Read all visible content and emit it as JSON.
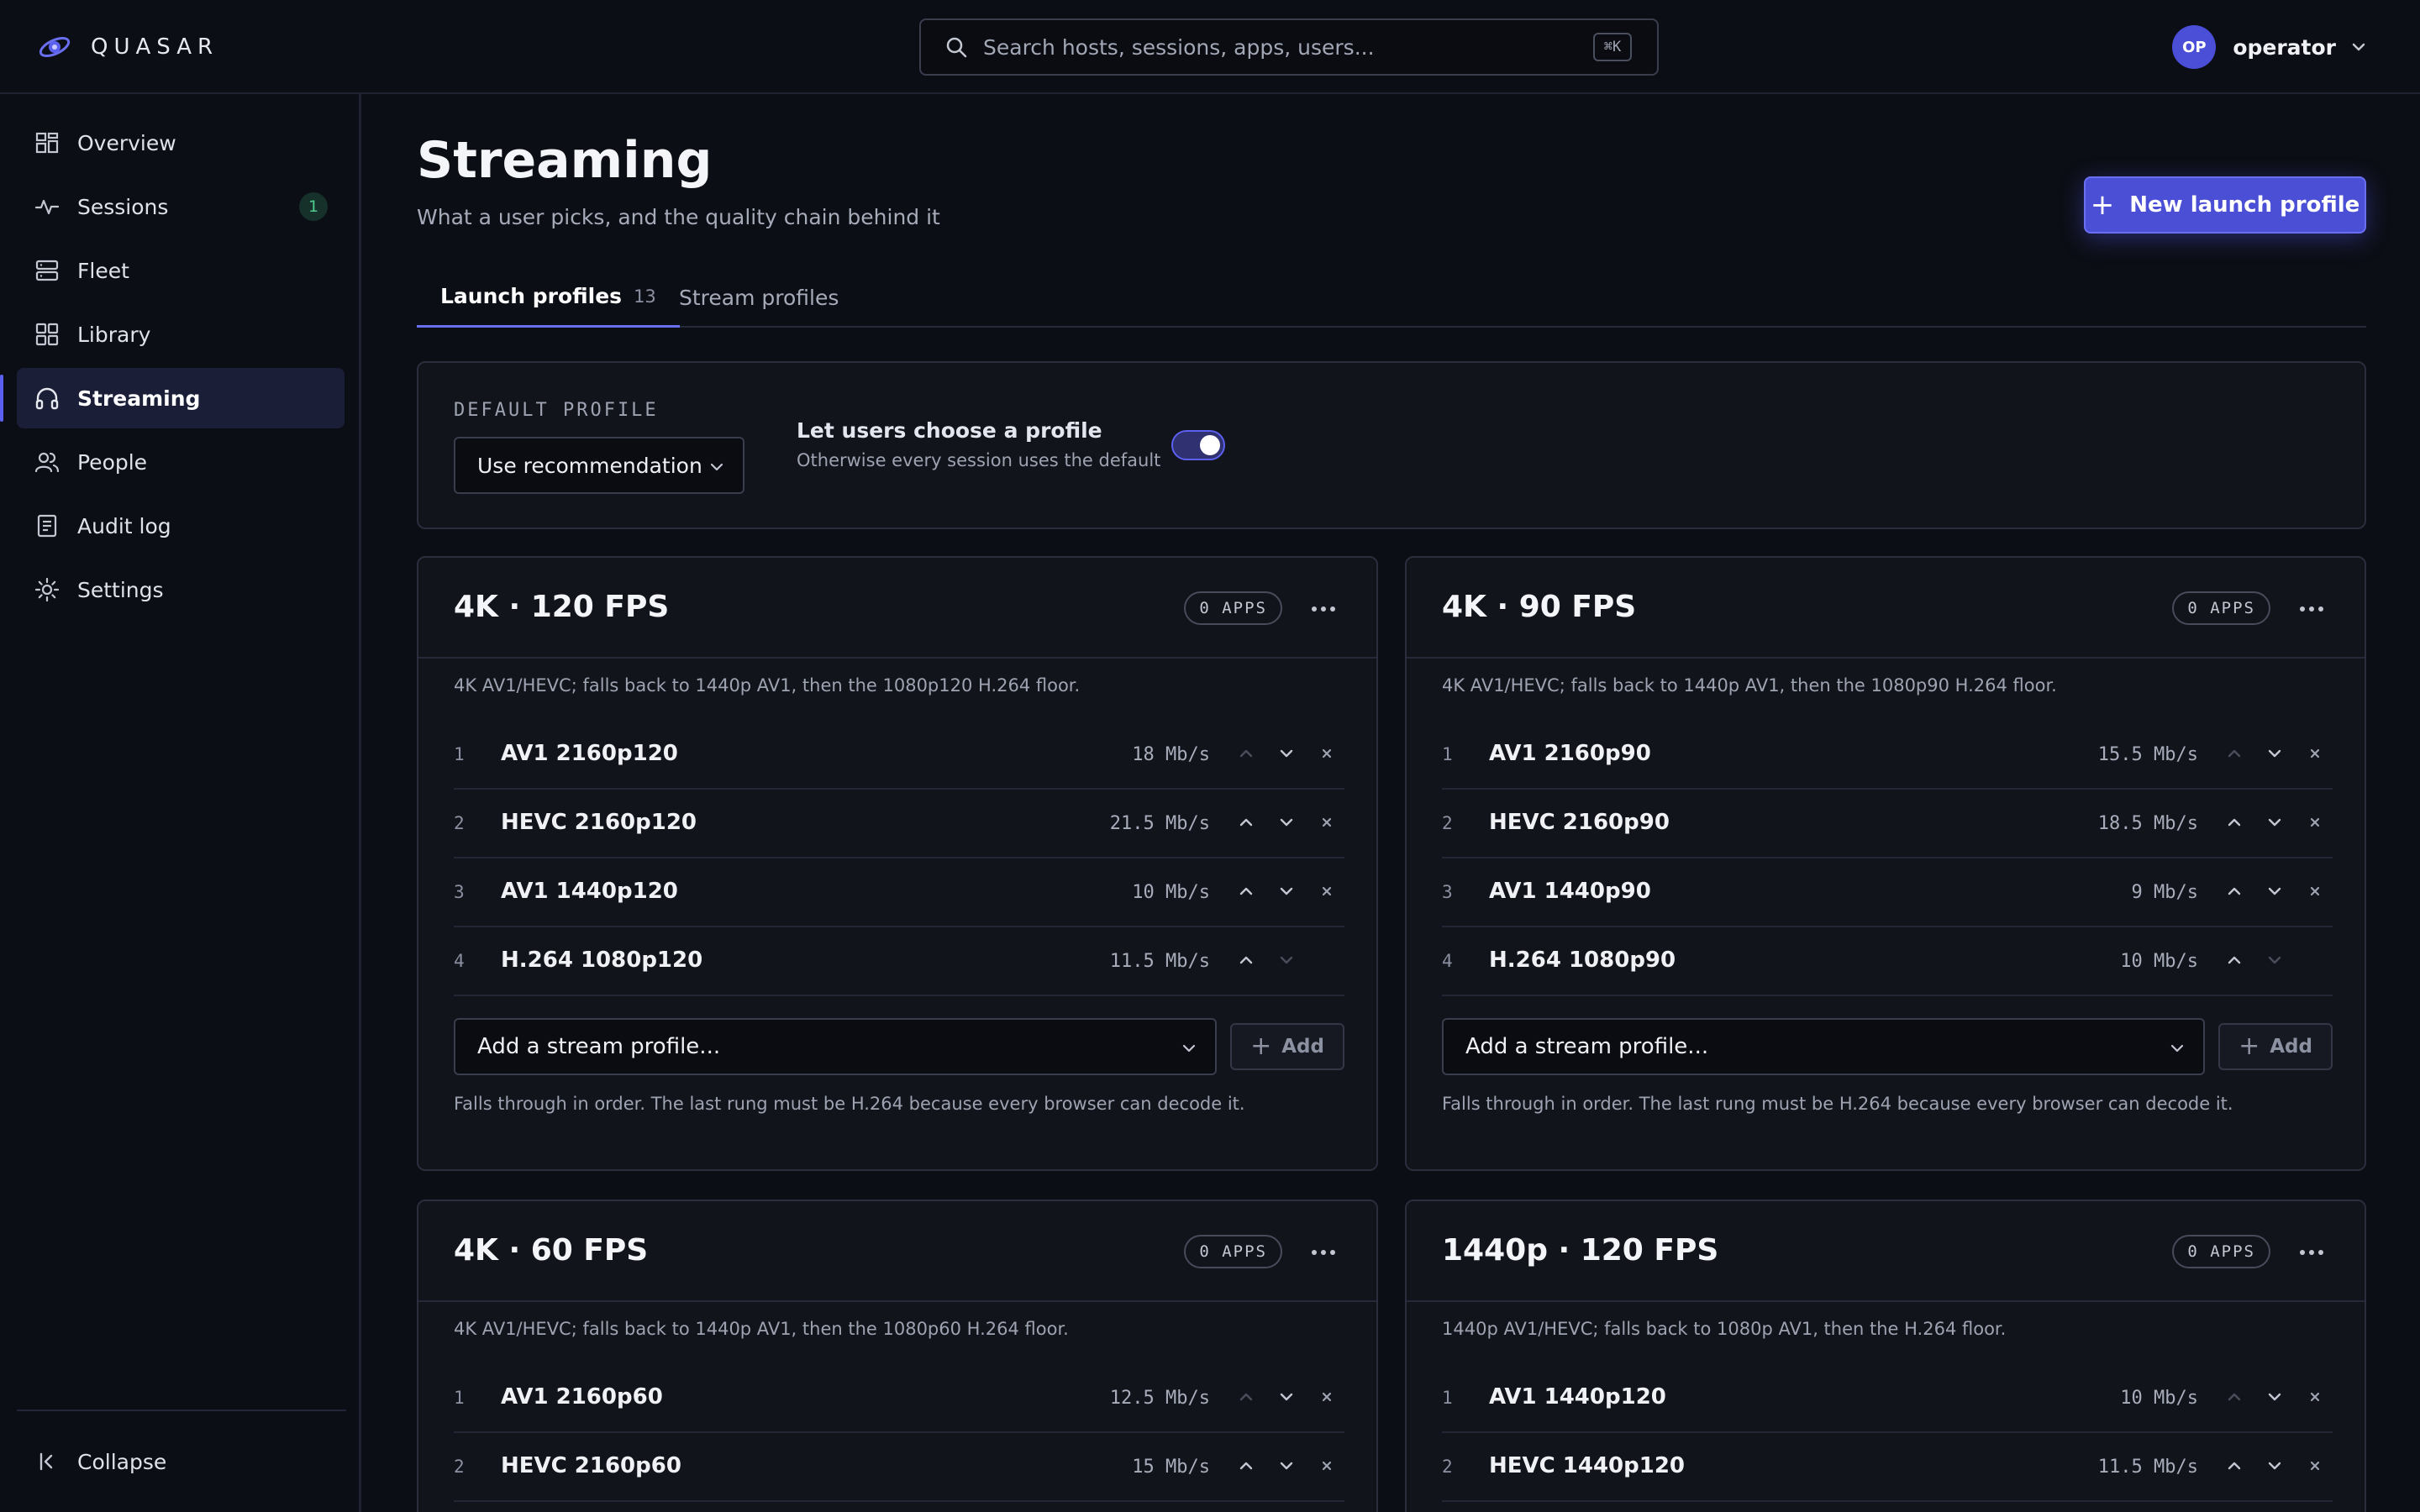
{
  "brand": {
    "name": "QUASAR"
  },
  "search": {
    "placeholder": "Search hosts, sessions, apps, users...",
    "shortcut": "⌘K"
  },
  "user": {
    "initials": "OP",
    "name": "operator"
  },
  "sidebar": {
    "items": [
      {
        "label": "Overview",
        "icon": "grid-icon"
      },
      {
        "label": "Sessions",
        "icon": "activity-icon",
        "badge": "1"
      },
      {
        "label": "Fleet",
        "icon": "server-icon"
      },
      {
        "label": "Library",
        "icon": "apps-icon"
      },
      {
        "label": "Streaming",
        "icon": "headphones-icon",
        "active": true
      },
      {
        "label": "People",
        "icon": "users-icon"
      },
      {
        "label": "Audit log",
        "icon": "document-icon"
      },
      {
        "label": "Settings",
        "icon": "gear-icon"
      }
    ],
    "collapse_label": "Collapse"
  },
  "page": {
    "title": "Streaming",
    "subtitle": "What a user picks, and the quality chain behind it",
    "primary_button": "New launch profile"
  },
  "tabs": [
    {
      "label": "Launch profiles",
      "count": "13",
      "active": true
    },
    {
      "label": "Stream profiles"
    }
  ],
  "default_profile": {
    "label": "DEFAULT PROFILE",
    "selected": "Use recommendation",
    "toggle_title": "Let users choose a profile",
    "toggle_subtitle": "Otherwise every session uses the default",
    "toggle_on": true
  },
  "cards": [
    {
      "title": "4K · 120 FPS",
      "apps": "0 APPS",
      "description": "4K AV1/HEVC; falls back to 1440p AV1, then the 1080p120 H.264 floor.",
      "rungs": [
        {
          "n": "1",
          "name": "AV1 2160p120",
          "rate": "18 Mb/s"
        },
        {
          "n": "2",
          "name": "HEVC 2160p120",
          "rate": "21.5 Mb/s"
        },
        {
          "n": "3",
          "name": "AV1 1440p120",
          "rate": "10 Mb/s"
        },
        {
          "n": "4",
          "name": "H.264 1080p120",
          "rate": "11.5 Mb/s"
        }
      ],
      "add_placeholder": "Add a stream profile...",
      "add_label": "Add",
      "footer": "Falls through in order. The last rung must be H.264 because every browser can decode it."
    },
    {
      "title": "4K · 90 FPS",
      "apps": "0 APPS",
      "description": "4K AV1/HEVC; falls back to 1440p AV1, then the 1080p90 H.264 floor.",
      "rungs": [
        {
          "n": "1",
          "name": "AV1 2160p90",
          "rate": "15.5 Mb/s"
        },
        {
          "n": "2",
          "name": "HEVC 2160p90",
          "rate": "18.5 Mb/s"
        },
        {
          "n": "3",
          "name": "AV1 1440p90",
          "rate": "9 Mb/s"
        },
        {
          "n": "4",
          "name": "H.264 1080p90",
          "rate": "10 Mb/s"
        }
      ],
      "add_placeholder": "Add a stream profile...",
      "add_label": "Add",
      "footer": "Falls through in order. The last rung must be H.264 because every browser can decode it."
    },
    {
      "title": "4K · 60 FPS",
      "apps": "0 APPS",
      "description": "4K AV1/HEVC; falls back to 1440p AV1, then the 1080p60 H.264 floor.",
      "rungs": [
        {
          "n": "1",
          "name": "AV1 2160p60",
          "rate": "12.5 Mb/s"
        },
        {
          "n": "2",
          "name": "HEVC 2160p60",
          "rate": "15 Mb/s"
        }
      ]
    },
    {
      "title": "1440p · 120 FPS",
      "apps": "0 APPS",
      "description": "1440p AV1/HEVC; falls back to 1080p AV1, then the H.264 floor.",
      "rungs": [
        {
          "n": "1",
          "name": "AV1 1440p120",
          "rate": "10 Mb/s"
        },
        {
          "n": "2",
          "name": "HEVC 1440p120",
          "rate": "11.5 Mb/s"
        }
      ]
    }
  ],
  "colors": {
    "background": "#0c0e15",
    "card": "#12141c",
    "accent": "#4a4fd6",
    "badge_green": "#4ecb8d"
  }
}
